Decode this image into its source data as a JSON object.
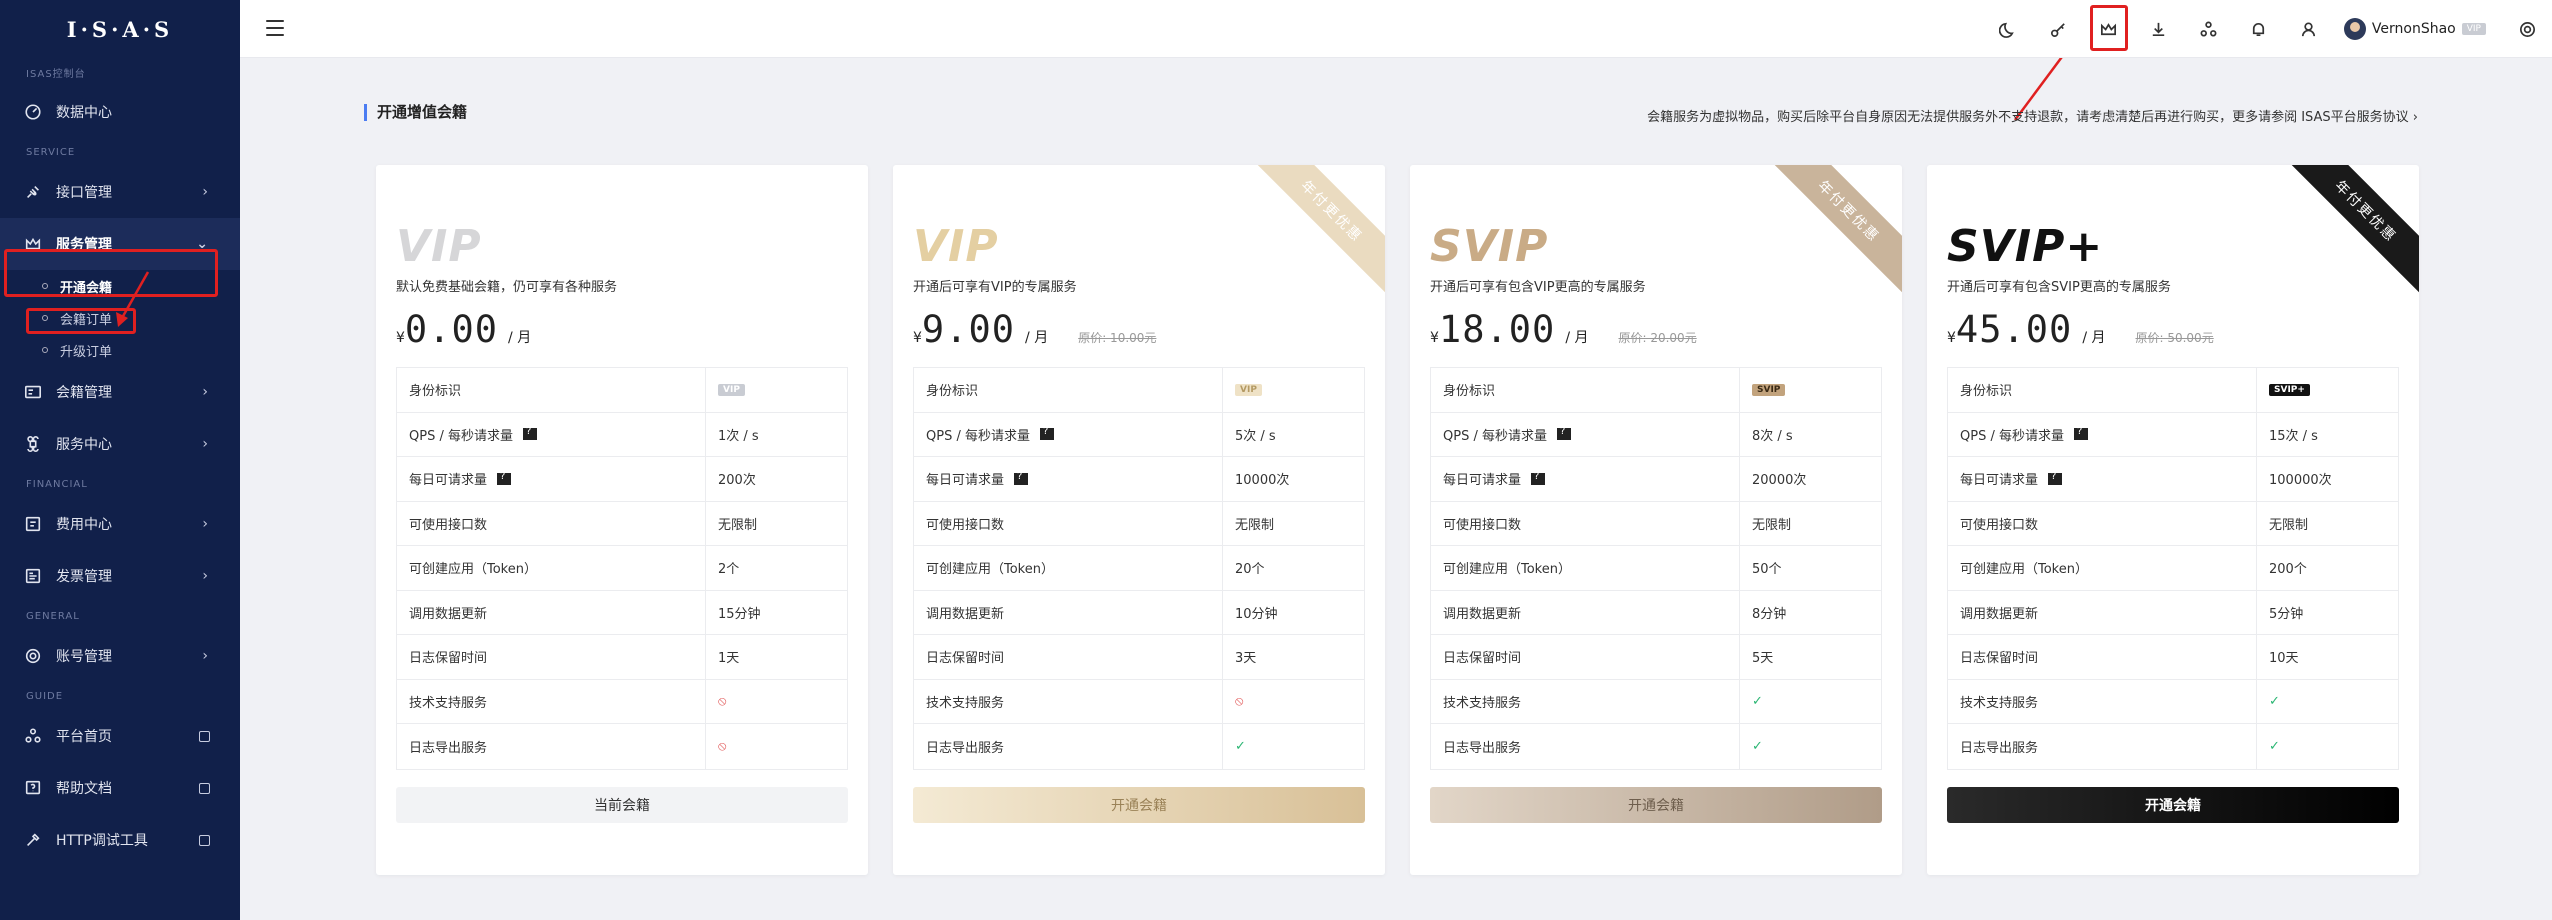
{
  "sidebar": {
    "logo": "I·S·A·S",
    "sections": {
      "s1": "ISAS控制台",
      "s2": "SERVICE",
      "s3": "FINANCIAL",
      "s4": "GENERAL",
      "s5": "GUIDE"
    },
    "items": {
      "data": "数据中心",
      "api": "接口管理",
      "service": "服务管理",
      "membership": "会籍管理",
      "svc_center": "服务中心",
      "fees": "费用中心",
      "invoice": "发票管理",
      "account": "账号管理",
      "platform": "平台首页",
      "docs": "帮助文档",
      "http": "HTTP调试工具"
    },
    "sub": {
      "open": "开通会籍",
      "orders": "会籍订单",
      "upgrade": "升级订单"
    }
  },
  "header": {
    "username": "VernonShao",
    "badge": "VIP"
  },
  "main": {
    "title": "开通增值会籍",
    "notice": "会籍服务为虚拟物品，购买后除平台自身原因无法提供服务外不支持退款，请考虑清楚后再进行购买，更多请参阅 ISAS平台服务协议 ›"
  },
  "features": [
    "身份标识",
    "QPS / 每秒请求量",
    "每日可请求量",
    "可使用接口数",
    "可创建应用（Token）",
    "调用数据更新",
    "日志保留时间",
    "技术支持服务",
    "日志导出服务"
  ],
  "plans": [
    {
      "logo": "VIP",
      "desc": "默认免费基础会籍，仍可享有各种服务",
      "currency": "¥",
      "price": "0.00",
      "unit": "/ 月",
      "orig": "",
      "ribbon": "",
      "tag": "VIP",
      "qps": "1次 / s",
      "daily": "200次",
      "apis": "无限制",
      "apps": "2个",
      "update": "15分钟",
      "retain": "1天",
      "support": "⦸",
      "export": "⦸",
      "button": "当前会籍"
    },
    {
      "logo": "VIP",
      "desc": "开通后可享有VIP的专属服务",
      "currency": "¥",
      "price": "9.00",
      "unit": "/ 月",
      "orig": "原价: 10.00元",
      "ribbon": "年付更优惠",
      "tag": "VIP",
      "qps": "5次 / s",
      "daily": "10000次",
      "apis": "无限制",
      "apps": "20个",
      "update": "10分钟",
      "retain": "3天",
      "support": "⦸",
      "export": "✓",
      "button": "开通会籍"
    },
    {
      "logo": "SVIP",
      "desc": "开通后可享有包含VIP更高的专属服务",
      "currency": "¥",
      "price": "18.00",
      "unit": "/ 月",
      "orig": "原价: 20.00元",
      "ribbon": "年付更优惠",
      "tag": "SVIP",
      "qps": "8次 / s",
      "daily": "20000次",
      "apis": "无限制",
      "apps": "50个",
      "update": "8分钟",
      "retain": "5天",
      "support": "✓",
      "export": "✓",
      "button": "开通会籍"
    },
    {
      "logo": "SVIP+",
      "desc": "开通后可享有包含SVIP更高的专属服务",
      "currency": "¥",
      "price": "45.00",
      "unit": "/ 月",
      "orig": "原价: 50.00元",
      "ribbon": "年付更优惠",
      "tag": "SVIP+",
      "qps": "15次 / s",
      "daily": "100000次",
      "apis": "无限制",
      "apps": "200个",
      "update": "5分钟",
      "retain": "10天",
      "support": "✓",
      "export": "✓",
      "button": "开通会籍"
    }
  ],
  "colors": {
    "sidebar_bg": "#11204a",
    "accent": "#4b7cf2",
    "highlight": "#e02020",
    "vip_gold": "#e6d2a8",
    "svip_bronze": "#bca48a",
    "svipplus_black": "#111111"
  }
}
